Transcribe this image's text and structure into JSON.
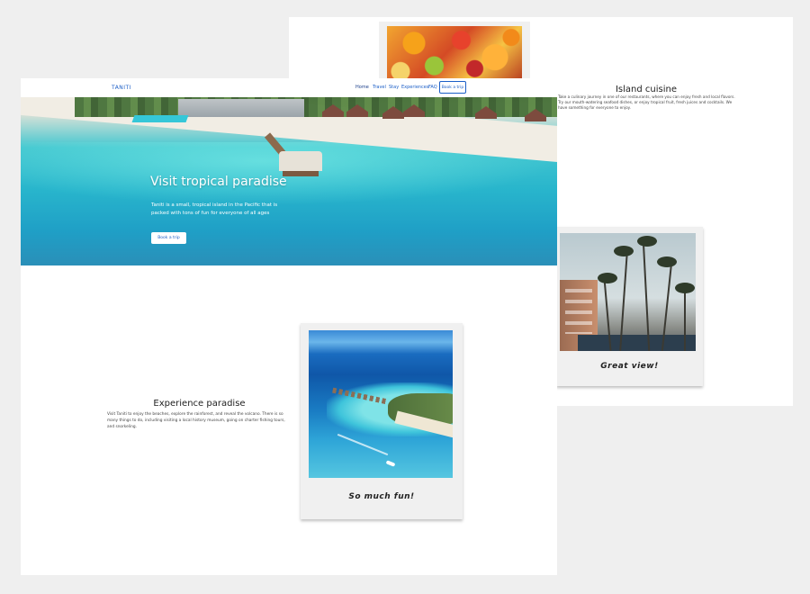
{
  "cuisine": {
    "title": "Island cuisine",
    "text": "Take a culinary journey in one of our restaurants, where you can enjoy fresh and local flavors. Try our mouth-watering seafood dishes, or enjoy tropical fruit, fresh juices and cocktails. We have something for everyone to enjoy."
  },
  "palm_card": {
    "caption": "Great view!"
  },
  "nav": {
    "brand": "TANITI",
    "links": [
      "Home",
      "Travel",
      "Stay",
      "Experiences",
      "FAQ"
    ],
    "cta": "Book a trip"
  },
  "hero": {
    "title": "Visit tropical paradise",
    "text": "Taniti is a small, tropical island in the Pacific that is packed with tons of fun for everyone of all ages",
    "button": "Book a trip"
  },
  "experience": {
    "title": "Experience paradise",
    "text": "Visit Taniti to enjoy the beaches, explore the rainforest, and reveal the volcano. There is so many things to do, including visiting a local history museum, going on charter fishing tours, and snorkeling."
  },
  "sea_card": {
    "caption": "So much fun!"
  },
  "colors": {
    "accent": "#1c5fc7",
    "background": "#efefef",
    "card": "#f0f0f0"
  }
}
